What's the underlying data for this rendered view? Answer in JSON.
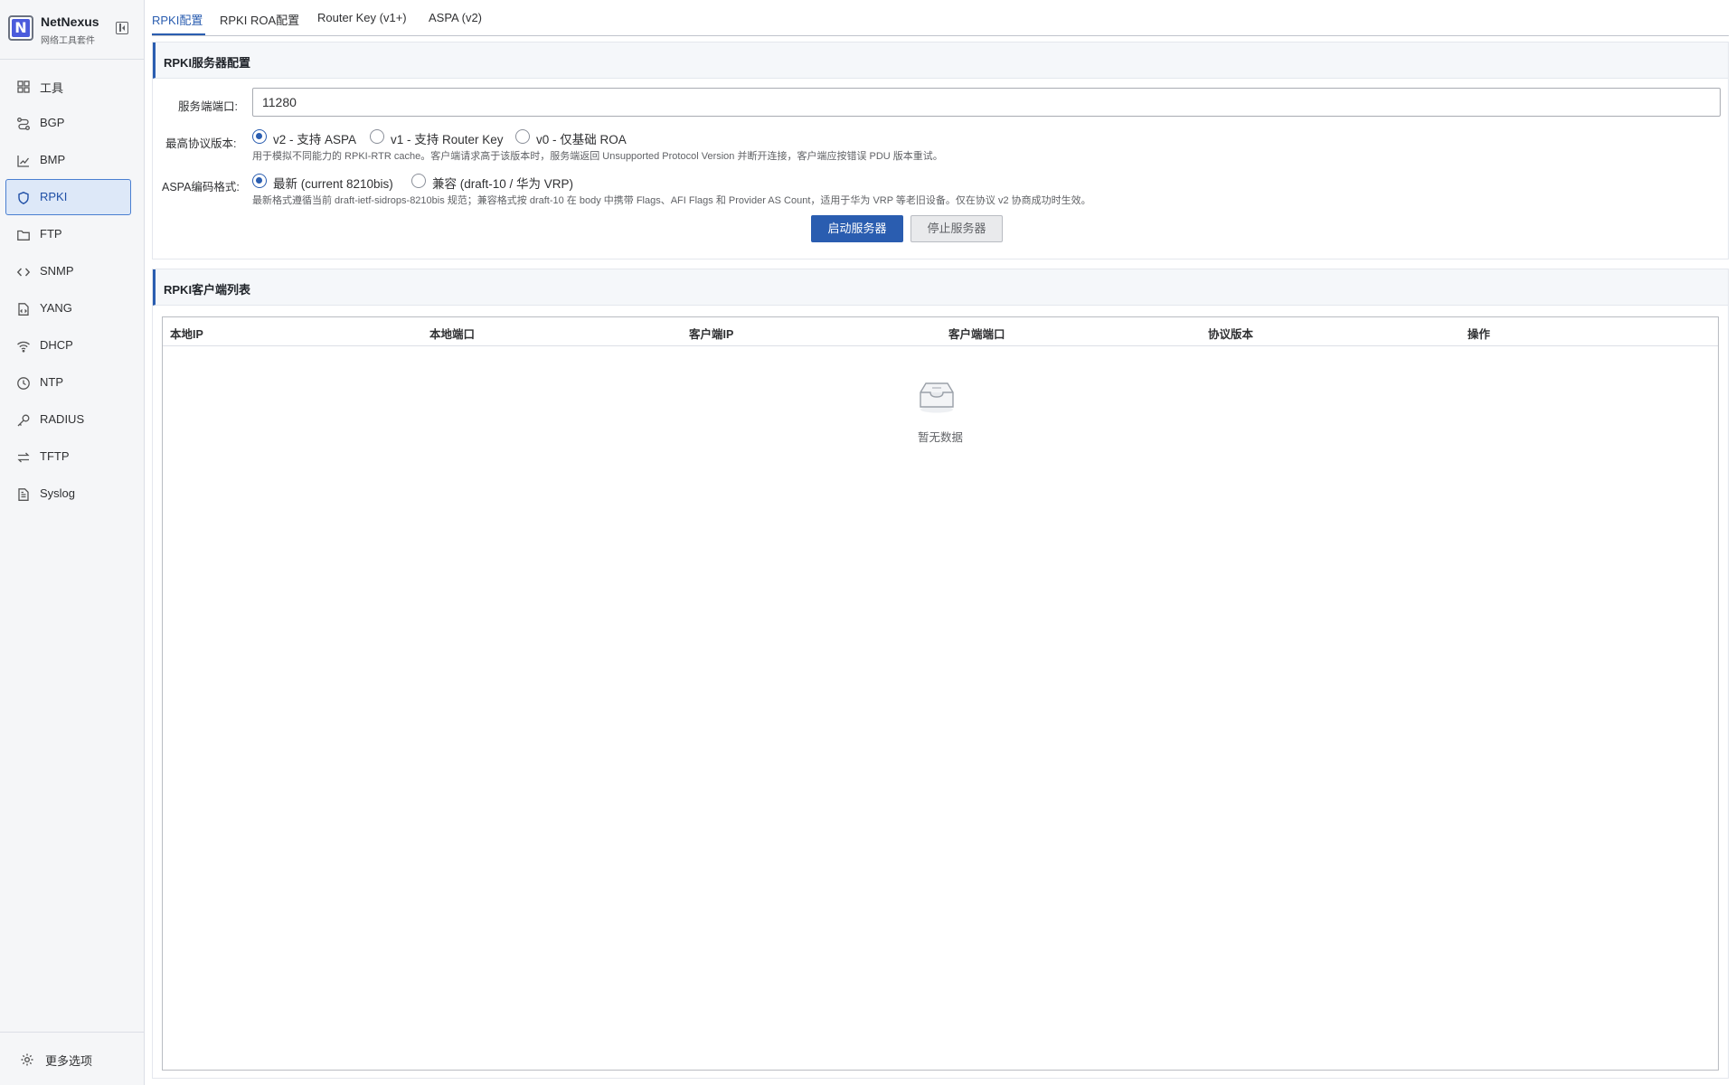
{
  "brand": {
    "name": "NetNexus",
    "subtitle": "网络工具套件",
    "logo_letter": "N"
  },
  "sidebar": {
    "items": [
      {
        "label": "工具",
        "icon": "grid-icon"
      },
      {
        "label": "BGP",
        "icon": "route-icon"
      },
      {
        "label": "BMP",
        "icon": "chart-icon"
      },
      {
        "label": "RPKI",
        "icon": "shield-icon",
        "active": true
      },
      {
        "label": "FTP",
        "icon": "folder-icon"
      },
      {
        "label": "SNMP",
        "icon": "code-icon"
      },
      {
        "label": "YANG",
        "icon": "file-code-icon"
      },
      {
        "label": "DHCP",
        "icon": "wifi-icon"
      },
      {
        "label": "NTP",
        "icon": "clock-icon"
      },
      {
        "label": "RADIUS",
        "icon": "key-icon"
      },
      {
        "label": "TFTP",
        "icon": "swap-icon"
      },
      {
        "label": "Syslog",
        "icon": "document-icon"
      }
    ],
    "footer_label": "更多选项"
  },
  "tabs": [
    {
      "label": "RPKI配置",
      "active": true
    },
    {
      "label": "RPKI ROA配置"
    },
    {
      "label": "Router Key (v1+)"
    },
    {
      "label": "ASPA (v2)"
    }
  ],
  "server_config": {
    "title": "RPKI服务器配置",
    "port_label": "服务端端口:",
    "port_value": "11280",
    "protocol_label": "最高协议版本:",
    "protocol_options": [
      "v2 - 支持 ASPA",
      "v1 - 支持 Router Key",
      "v0 - 仅基础 ROA"
    ],
    "protocol_selected": "v2 - 支持 ASPA",
    "protocol_hint": "用于模拟不同能力的 RPKI-RTR cache。客户端请求高于该版本时，服务端返回 Unsupported Protocol Version 并断开连接，客户端应按错误 PDU 版本重试。",
    "aspa_label": "ASPA编码格式:",
    "aspa_options": [
      "最新 (current 8210bis)",
      "兼容 (draft-10 / 华为 VRP)"
    ],
    "aspa_selected": "最新 (current 8210bis)",
    "aspa_hint": "最新格式遵循当前 draft-ietf-sidrops-8210bis 规范；兼容格式按 draft-10 在 body 中携带 Flags、AFI Flags 和 Provider AS Count，适用于华为 VRP 等老旧设备。仅在协议 v2 协商成功时生效。",
    "start_button": "启动服务器",
    "stop_button": "停止服务器"
  },
  "client_list": {
    "title": "RPKI客户端列表",
    "columns": [
      "本地IP",
      "本地端口",
      "客户端IP",
      "客户端端口",
      "协议版本",
      "操作"
    ],
    "rows": [],
    "empty_text": "暂无数据"
  },
  "colors": {
    "accent": "#2a5db0",
    "active_bg": "#dde8f8",
    "sidebar_bg": "#f5f6f8"
  }
}
